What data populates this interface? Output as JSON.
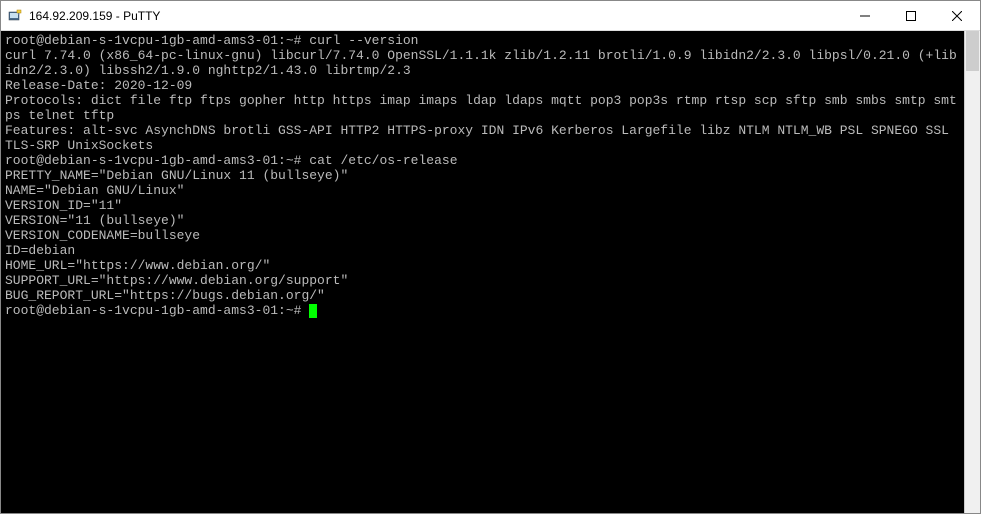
{
  "window": {
    "title": "164.92.209.159 - PuTTY"
  },
  "terminal": {
    "prompt": "root@debian-s-1vcpu-1gb-amd-ams3-01:~#",
    "cmd1": "curl --version",
    "out1_l1": "curl 7.74.0 (x86_64-pc-linux-gnu) libcurl/7.74.0 OpenSSL/1.1.1k zlib/1.2.11 brotli/1.0.9 libidn2/2.3.0 libpsl/0.21.0 (+libidn2/2.3.0) libssh2/1.9.0 nghttp2/1.43.0 librtmp/2.3",
    "out1_l2": "Release-Date: 2020-12-09",
    "out1_l3": "Protocols: dict file ftp ftps gopher http https imap imaps ldap ldaps mqtt pop3 pop3s rtmp rtsp scp sftp smb smbs smtp smtps telnet tftp",
    "out1_l4": "Features: alt-svc AsynchDNS brotli GSS-API HTTP2 HTTPS-proxy IDN IPv6 Kerberos Largefile libz NTLM NTLM_WB PSL SPNEGO SSL TLS-SRP UnixSockets",
    "cmd2": "cat /etc/os-release",
    "out2_l1": "PRETTY_NAME=\"Debian GNU/Linux 11 (bullseye)\"",
    "out2_l2": "NAME=\"Debian GNU/Linux\"",
    "out2_l3": "VERSION_ID=\"11\"",
    "out2_l4": "VERSION=\"11 (bullseye)\"",
    "out2_l5": "VERSION_CODENAME=bullseye",
    "out2_l6": "ID=debian",
    "out2_l7": "HOME_URL=\"https://www.debian.org/\"",
    "out2_l8": "SUPPORT_URL=\"https://www.debian.org/support\"",
    "out2_l9": "BUG_REPORT_URL=\"https://bugs.debian.org/\""
  }
}
